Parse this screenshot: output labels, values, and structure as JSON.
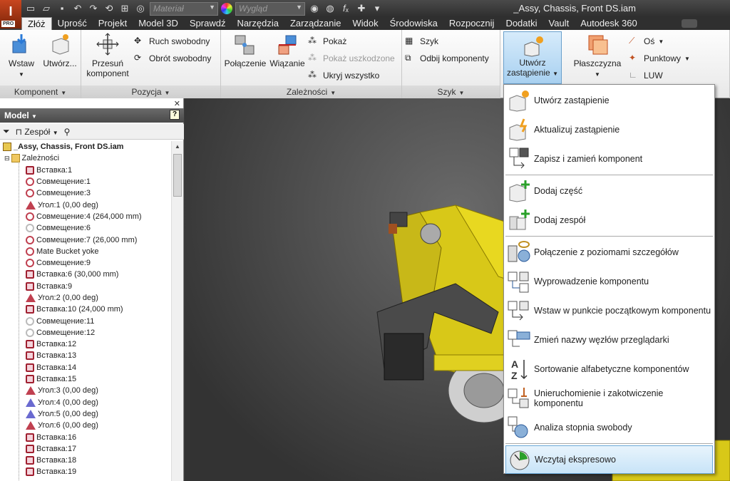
{
  "app": {
    "logo_letter": "I",
    "edition": "PRO"
  },
  "window": {
    "title": "_Assy, Chassis, Front DS.iam"
  },
  "qat": {
    "material": "Materiał",
    "appearance": "Wygląd"
  },
  "tabs": [
    "Złóż",
    "Uprość",
    "Projekt",
    "Model 3D",
    "Sprawdź",
    "Narzędzia",
    "Zarządzanie",
    "Widok",
    "Środowiska",
    "Rozpocznij",
    "Dodatki",
    "Vault",
    "Autodesk 360"
  ],
  "ribbon": {
    "komponent": {
      "label": "Komponent",
      "wstaw": "Wstaw",
      "utworz": "Utwórz..."
    },
    "pozycja": {
      "label": "Pozycja",
      "przesun": "Przesuń komponent",
      "ruch": "Ruch swobodny",
      "obrot": "Obrót swobodny"
    },
    "zaleznosci": {
      "label": "Zależności",
      "polaczenie": "Połączenie",
      "wiazanie": "Wiązanie",
      "pokaz": "Pokaż",
      "pokaz_uszk": "Pokaż uszkodzone",
      "ukryj": "Ukryj wszystko"
    },
    "szyk": {
      "label": "Szyk",
      "szyk": "Szyk",
      "odbij": "Odbij komponenty"
    },
    "zastepienie": {
      "label": "Utwórz zastąpienie"
    },
    "plaszczyzna": {
      "label": "Płaszczyzna",
      "os": "Oś",
      "punktowy": "Punktowy",
      "luw": "LUW"
    }
  },
  "browser": {
    "title": "Model",
    "filter": "Zespół",
    "root": "_Assy, Chassis, Front DS.iam",
    "folder": "Zależności",
    "nodes": [
      {
        "type": "ins",
        "label": "Вставка:1"
      },
      {
        "type": "mate",
        "label": "Совмещение:1"
      },
      {
        "type": "mate",
        "label": "Совмещение:3"
      },
      {
        "type": "ang",
        "label": "Угол:1 (0,00 deg)"
      },
      {
        "type": "mate",
        "label": "Совмещение:4 (264,000 mm)"
      },
      {
        "type": "mate-grey",
        "label": "Совмещение:6"
      },
      {
        "type": "mate",
        "label": "Совмещение:7 (26,000 mm)"
      },
      {
        "type": "mate",
        "label": "Mate Bucket yoke"
      },
      {
        "type": "mate",
        "label": "Совмещение:9"
      },
      {
        "type": "ins",
        "label": "Вставка:6 (30,000 mm)"
      },
      {
        "type": "ins",
        "label": "Вставка:9"
      },
      {
        "type": "ang",
        "label": "Угол:2 (0,00 deg)"
      },
      {
        "type": "ins",
        "label": "Вставка:10 (24,000 mm)"
      },
      {
        "type": "mate-grey",
        "label": "Совмещение:11"
      },
      {
        "type": "mate-grey",
        "label": "Совмещение:12"
      },
      {
        "type": "ins",
        "label": "Вставка:12"
      },
      {
        "type": "ins",
        "label": "Вставка:13"
      },
      {
        "type": "ins",
        "label": "Вставка:14"
      },
      {
        "type": "ins",
        "label": "Вставка:15"
      },
      {
        "type": "ang",
        "label": "Угол:3 (0,00 deg)"
      },
      {
        "type": "ang-blue",
        "label": "Угол:4 (0,00 deg)"
      },
      {
        "type": "ang-blue",
        "label": "Угол:5 (0,00 deg)"
      },
      {
        "type": "ang",
        "label": "Угол:6 (0,00 deg)"
      },
      {
        "type": "ins",
        "label": "Вставка:16"
      },
      {
        "type": "ins",
        "label": "Вставка:17"
      },
      {
        "type": "ins",
        "label": "Вставка:18"
      },
      {
        "type": "ins",
        "label": "Вставка:19"
      }
    ]
  },
  "menu": {
    "items": [
      "Utwórz zastąpienie",
      "Aktualizuj zastąpienie",
      "Zapisz i zamień komponent",
      "Dodaj część",
      "Dodaj zespół",
      "Połączenie z poziomami szczegółów",
      "Wyprowadzenie komponentu",
      "Wstaw w punkcie początkowym komponentu",
      "Zmień nazwy węzłów przeglądarki",
      "Sortowanie alfabetyczne komponentów",
      "Unieruchomienie i zakotwiczenie komponentu",
      "Analiza stopnia swobody",
      "Wczytaj ekspresowo"
    ],
    "highlighted": "Wczytaj ekspresowo"
  }
}
